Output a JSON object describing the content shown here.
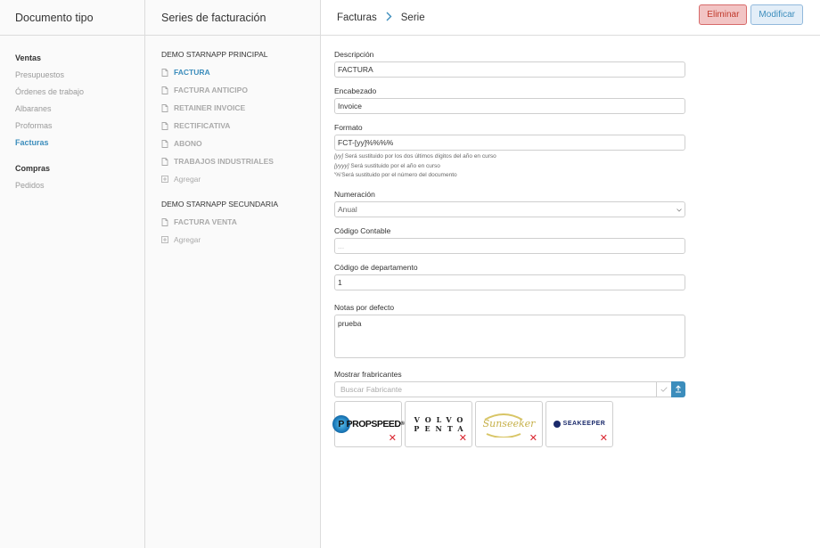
{
  "doc_types": {
    "title": "Documento tipo",
    "groups": [
      {
        "label": "Ventas",
        "items": [
          {
            "label": "Presupuestos",
            "active": false
          },
          {
            "label": "Órdenes de trabajo",
            "active": false
          },
          {
            "label": "Albaranes",
            "active": false
          },
          {
            "label": "Proformas",
            "active": false
          },
          {
            "label": "Facturas",
            "active": true
          }
        ]
      },
      {
        "label": "Compras",
        "items": [
          {
            "label": "Pedidos",
            "active": false
          }
        ]
      }
    ]
  },
  "series": {
    "title": "Series de facturación",
    "groups": [
      {
        "label": "DEMO STARNAPP PRINCIPAL",
        "items": [
          "FACTURA",
          "FACTURA ANTICIPO",
          "RETAINER INVOICE",
          "RECTIFICATIVA",
          "ABONO",
          "TRABAJOS INDUSTRIALES"
        ],
        "active_index": 0,
        "add_label": "Agregar"
      },
      {
        "label": "DEMO STARNAPP SECUNDARIA",
        "items": [
          "FACTURA VENTA"
        ],
        "active_index": -1,
        "add_label": "Agregar"
      }
    ]
  },
  "main": {
    "breadcrumb": {
      "parent": "Facturas",
      "current": "Serie"
    },
    "delete_label": "Eliminar",
    "modify_label": "Modificar",
    "form": {
      "descripcion": {
        "label": "Descripción",
        "value": "FACTURA"
      },
      "encabezado": {
        "label": "Encabezado",
        "value": "Invoice"
      },
      "formato": {
        "label": "Formato",
        "value": "FCT-[yy]%%%%",
        "help": [
          {
            "code": "[yy]",
            "text": " Será sustituido por los dos últimos dígitos del año en curso"
          },
          {
            "code": "[yyyy]",
            "text": " Será sustituido por el año en curso"
          },
          {
            "code": "'%'",
            "text": "Será sustituido por el número del documento"
          }
        ]
      },
      "numeracion": {
        "label": "Numeración",
        "value": "Anual"
      },
      "codigo_contable": {
        "label": "Código Contable",
        "placeholder": "..."
      },
      "codigo_departamento": {
        "label": "Código de departamento",
        "value": "1"
      },
      "notas": {
        "label": "Notas por defecto",
        "value": "prueba"
      },
      "fabricantes": {
        "label": "Mostrar frabricantes",
        "search_placeholder": "Buscar Fabricante",
        "logos": [
          {
            "name": "PROPSPEED",
            "suffix": "®"
          },
          {
            "name": "VOLVO PENTA",
            "line1": "VOLVO",
            "line2": "PENTA"
          },
          {
            "name": "Sunseeker"
          },
          {
            "name": "SEAKEEPER"
          }
        ],
        "remove_glyph": "✕"
      }
    }
  }
}
